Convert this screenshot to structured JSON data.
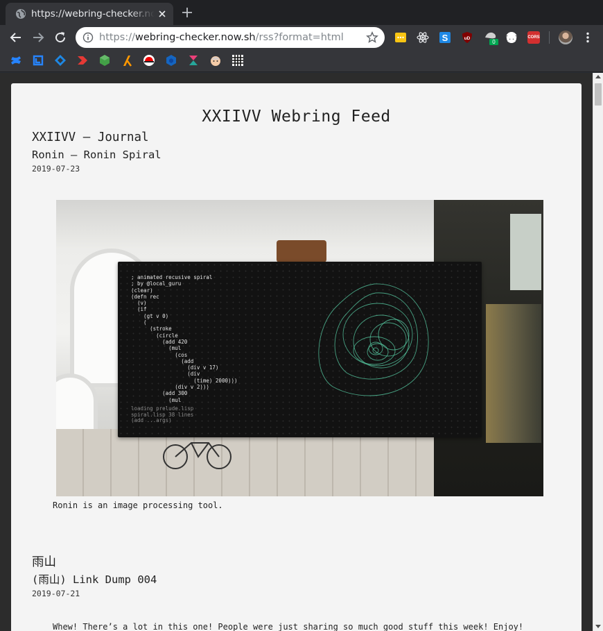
{
  "tab": {
    "title": "https://webring-checker.now.sh/rss?format=html",
    "favicon": "globe-icon"
  },
  "omnibox": {
    "scheme": "https://",
    "host": "webring-checker.now.sh",
    "path": "/rss?format=html"
  },
  "extensions": [
    {
      "name": "notes-extension-icon",
      "color": "#f9c513"
    },
    {
      "name": "react-devtools-icon",
      "color": "#61dafb"
    },
    {
      "name": "s-extension-icon",
      "color": "#1e88e5"
    },
    {
      "name": "ublock-origin-icon",
      "color": "#800000"
    },
    {
      "name": "cookie-extension-icon",
      "color": "#cfcfcf",
      "badge": "0"
    },
    {
      "name": "json-formatter-icon",
      "color": "#ffffff"
    },
    {
      "name": "cors-extension-icon",
      "color": "#d32f2f",
      "label": "CORS"
    }
  ],
  "bookmarks": [
    {
      "name": "confluence-bookmark-icon",
      "color": "#2684ff"
    },
    {
      "name": "jira-software-bookmark-icon",
      "color": "#2684ff"
    },
    {
      "name": "jira-bookmark-icon",
      "color": "#1e88e5"
    },
    {
      "name": "red-arrow-bookmark-icon",
      "color": "#e53935"
    },
    {
      "name": "green-cube-bookmark-icon",
      "color": "#43a047"
    },
    {
      "name": "orange-lambda-bookmark-icon",
      "color": "#ff9800"
    },
    {
      "name": "redhat-bookmark-icon",
      "color": "#ee0000"
    },
    {
      "name": "blue-cube-bookmark-icon",
      "color": "#1565c0"
    },
    {
      "name": "teal-k-bookmark-icon",
      "color": "#26a69a"
    },
    {
      "name": "face-bookmark-icon",
      "color": "#f5cba7"
    },
    {
      "name": "grid-bookmark-icon",
      "color": "#ffffff"
    }
  ],
  "page": {
    "title": "XXIIVV Webring Feed",
    "entries": [
      {
        "source": "XXIIVV — Journal",
        "title": "Ronin — Ronin Spiral",
        "date": "2019-07-23",
        "caption": "Ronin is an image processing tool."
      },
      {
        "source": "雨山",
        "title": "(雨山) Link Dump 004",
        "date": "2019-07-21",
        "excerpt": "Whew! There’s a lot in this one! People were just sharing so much good stuff this week! Enjoy!"
      }
    ],
    "ronin_code": "; animated recusive spiral\n; by @local_guru\n(clear)\n(defn rec\n  (v)\n  (if\n    (gt v 0)\n    (\n      (stroke\n        (circle\n          (add 420\n            (mul\n              (cos\n                (add\n                  (div v 17)\n                  (div\n                    (time) 2000)))\n              (div v 2)))\n          (add 300\n            (mul",
    "ronin_status": "loading prelude.lisp\nspiral.lisp 38 lines\n(add ...args)"
  }
}
